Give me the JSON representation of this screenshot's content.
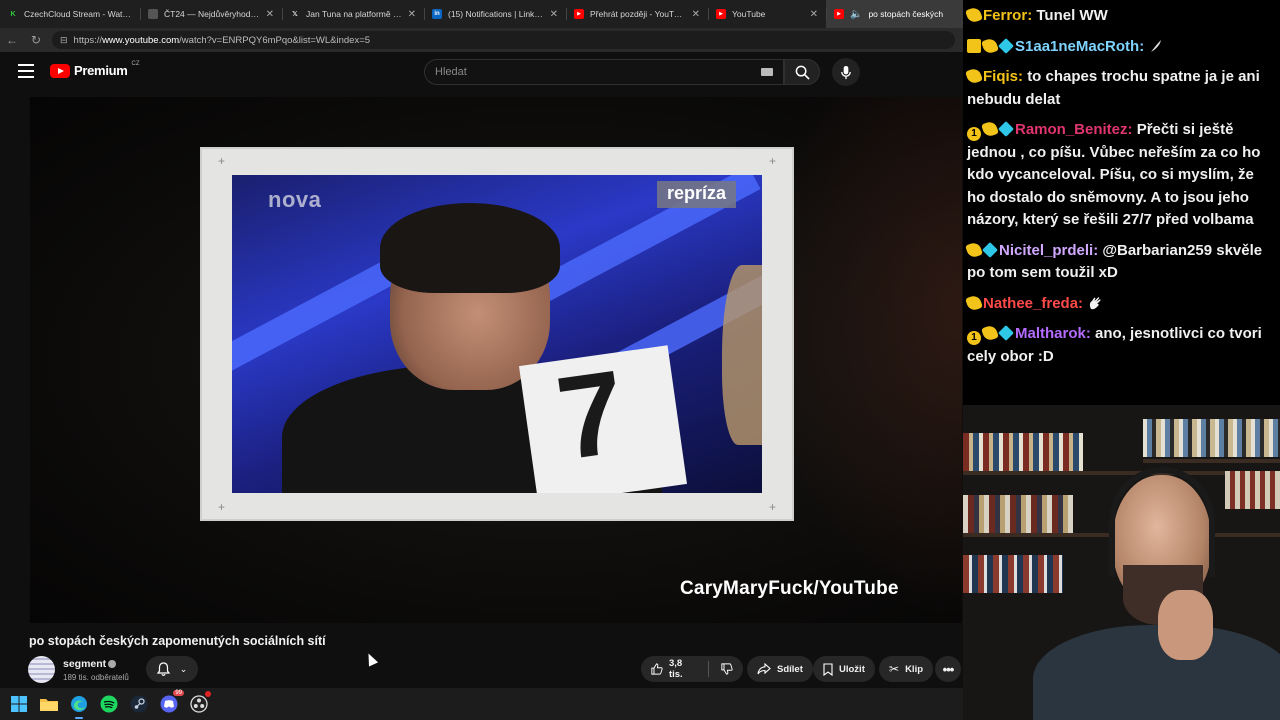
{
  "browser": {
    "tabs": [
      {
        "label": "CzechCloud Stream - Watch L",
        "icon": "czechcloud-k-icon",
        "color": "#2ecc40",
        "glyph": "K"
      },
      {
        "label": "ČT24 — Nejdůvěryhodnější z",
        "icon": "ct24-icon",
        "color": "#555555",
        "glyph": ""
      },
      {
        "label": "Jan Tuna na platformě X: „Mi",
        "icon": "x-icon",
        "color": "#000000",
        "glyph": "X"
      },
      {
        "label": "(15) Notifications | LinkedIn",
        "icon": "linkedin-icon",
        "color": "#0a66c2",
        "glyph": "in"
      },
      {
        "label": "Přehrát později - YouTube",
        "icon": "youtube-icon",
        "color": "#ff0000",
        "glyph": "▶"
      },
      {
        "label": "YouTube",
        "icon": "youtube-icon",
        "color": "#ff0000",
        "glyph": "▶"
      },
      {
        "label": "po stopách českých",
        "icon": "youtube-icon",
        "color": "#ff0000",
        "glyph": "▶",
        "active": true,
        "audio": "speaker-icon"
      }
    ],
    "url_prefix": "https://",
    "url_host": "www.youtube.com",
    "url_path": "/watch?v=ENRPQY6mPqo&list=WL&index=5"
  },
  "youtube": {
    "brand": "Premium",
    "country": "CZ",
    "search_placeholder": "Hledat",
    "video_title": "po stopách českých zapomenutých sociálních sítí",
    "channel_name": "segment",
    "subscribers": "189 tis. odběratelů",
    "likes": "3,8 tis.",
    "share_label": "Sdílet",
    "save_label": "Uložit",
    "clip_label": "Klip"
  },
  "video": {
    "station_logo": "nova",
    "rerun_badge": "repríza",
    "card_number": "7",
    "watermark": "CaryMaryFuck/YouTube"
  },
  "chat": {
    "messages": [
      {
        "badges": [
          "sub"
        ],
        "user": "Ferror",
        "color": "#f2c318",
        "text": "Tunel WW",
        "emote": ""
      },
      {
        "badges": [
          "crown",
          "sub",
          "gift"
        ],
        "user": "S1aa1neMacRoth",
        "color": "#7fd3ff",
        "text": "",
        "emote": "feather-emote"
      },
      {
        "badges": [
          "sub"
        ],
        "user": "Fiqis",
        "color": "#f2c318",
        "text": "to chapes trochu spatne ja je ani nebudu delat",
        "emote": ""
      },
      {
        "badges": [
          "one",
          "sub",
          "gift"
        ],
        "user": "Ramon_Benitez",
        "color": "#e0356f",
        "text": "Přečti si ještě jednou , co píšu. Vůbec neřeším za co ho kdo vycanceloval. Píšu, co si myslím, že ho dostalo do sněmovny. A to jsou jeho názory, který se řešili 27/7 před volbama",
        "emote": ""
      },
      {
        "badges": [
          "sub",
          "gift"
        ],
        "user": "Nicitel_prdeli",
        "color": "#d0a8ff",
        "text": "@Barbarian259 skvěle po tom sem toužil xD",
        "emote": ""
      },
      {
        "badges": [
          "sub"
        ],
        "user": "Nathee_freda",
        "color": "#ff4a4a",
        "text": "",
        "emote": "wave-emote"
      },
      {
        "badges": [
          "one",
          "sub",
          "gift"
        ],
        "user": "Maltharok",
        "color": "#b36cff",
        "text": "ano, jesnotlivci co tvori cely obor :D",
        "emote": ""
      }
    ]
  },
  "taskbar": {
    "apps": [
      "windows-start-icon",
      "file-explorer-icon",
      "edge-icon",
      "spotify-icon",
      "steam-icon",
      "discord-icon",
      "obs-icon"
    ],
    "discord_badge": "99"
  }
}
